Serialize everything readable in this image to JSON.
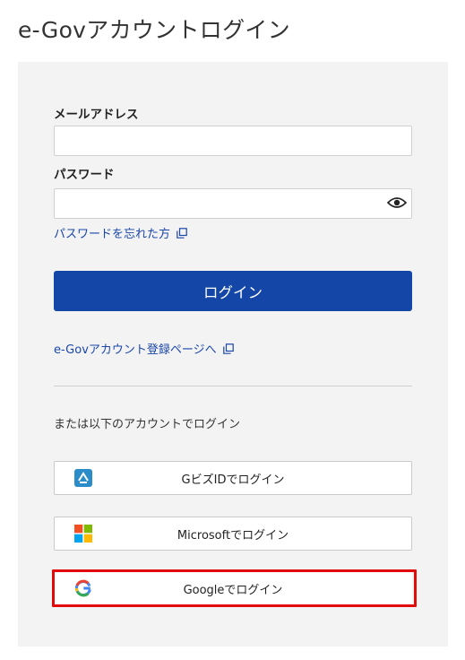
{
  "page": {
    "title": "e-Govアカウントログイン"
  },
  "form": {
    "email_label": "メールアドレス",
    "email_value": "",
    "password_label": "パスワード",
    "password_value": "",
    "forgot_password_link": "パスワードを忘れた方",
    "login_button": "ログイン",
    "register_link": "e-Govアカウント登録ページへ"
  },
  "alternatives": {
    "heading": "または以下のアカウントでログイン",
    "buttons": [
      {
        "label": "GビズIDでログイン",
        "icon": "gbizid-icon"
      },
      {
        "label": "Microsoftでログイン",
        "icon": "microsoft-icon"
      },
      {
        "label": "Googleでログイン",
        "icon": "google-icon"
      }
    ]
  },
  "colors": {
    "primary": "#1346a6",
    "link": "#1a47a8",
    "panel": "#f3f3f4",
    "highlight": "#e20b0b"
  }
}
